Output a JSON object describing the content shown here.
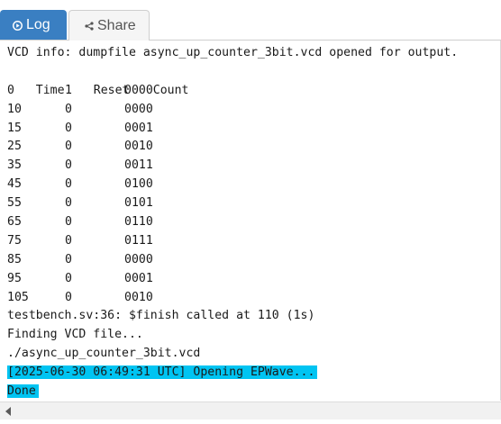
{
  "tabs": {
    "log_label": "Log",
    "share_label": "Share",
    "log_icon": "play-circle-icon",
    "share_icon": "share-icon",
    "active_color": "#3a7fc2"
  },
  "console": {
    "vcd_info": "VCD info: dumpfile async_up_counter_3bit.vcd opened for output.",
    "header": {
      "time": "Time",
      "reset": "Reset",
      "count": "Count"
    },
    "rows": [
      {
        "time": "0",
        "reset": "1",
        "count": "0000"
      },
      {
        "time": "10",
        "reset": "0",
        "count": "0000"
      },
      {
        "time": "15",
        "reset": "0",
        "count": "0001"
      },
      {
        "time": "25",
        "reset": "0",
        "count": "0010"
      },
      {
        "time": "35",
        "reset": "0",
        "count": "0011"
      },
      {
        "time": "45",
        "reset": "0",
        "count": "0100"
      },
      {
        "time": "55",
        "reset": "0",
        "count": "0101"
      },
      {
        "time": "65",
        "reset": "0",
        "count": "0110"
      },
      {
        "time": "75",
        "reset": "0",
        "count": "0111"
      },
      {
        "time": "85",
        "reset": "0",
        "count": "0000"
      },
      {
        "time": "95",
        "reset": "0",
        "count": "0001"
      },
      {
        "time": "105",
        "reset": "0",
        "count": "0010"
      }
    ],
    "finish_line": "testbench.sv:36: $finish called at 110 (1s)",
    "finding_line": "Finding VCD file...",
    "vcd_path_line": "./async_up_counter_3bit.vcd",
    "epwave_line": "[2025-06-30 06:49:31 UTC] Opening EPWave...",
    "done_line": "Done",
    "highlight_color": "#00c4f2"
  },
  "scrollbar": {
    "left_arrow_icon": "scroll-left-arrow-icon"
  }
}
